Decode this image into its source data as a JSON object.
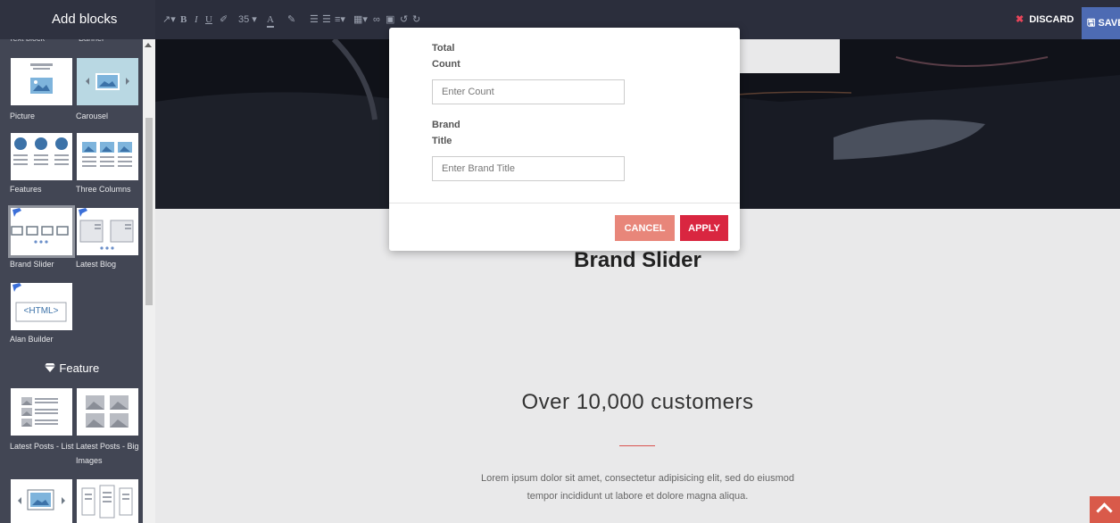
{
  "sidebar": {
    "title": "Add blocks",
    "cut_labels": [
      "Text block",
      "Banner"
    ],
    "blocks": [
      {
        "label": "Picture"
      },
      {
        "label": "Carousel"
      },
      {
        "label": "Features"
      },
      {
        "label": "Three Columns"
      },
      {
        "label": "Brand Slider"
      },
      {
        "label": "Latest Blog"
      },
      {
        "label": "Alan Builder",
        "tile_text": "<HTML>"
      },
      {
        "label": "Latest Posts - List"
      },
      {
        "label": "Latest Posts - Big Images"
      }
    ],
    "section_title": "Feature"
  },
  "toolbar": {
    "font_size": "35",
    "discard_label": "DISCARD",
    "save_label": "SAVE"
  },
  "content": {
    "heading": "Brand Slider",
    "customers_heading": "Over 10,000 customers",
    "lorem_line1": "Lorem ipsum dolor sit amet, consectetur adipisicing elit, sed do eiusmod",
    "lorem_line2": "tempor incididunt ut labore et dolore magna aliqua."
  },
  "modal": {
    "count_label_1": "Total",
    "count_label_2": "Count",
    "count_placeholder": "Enter Count",
    "brand_label_1": "Brand",
    "brand_label_2": "Title",
    "brand_placeholder": "Enter Brand Title",
    "cancel_label": "CANCEL",
    "apply_label": "APPLY"
  },
  "colors": {
    "sidebar_bg": "#424654",
    "toolbar_bg": "#2b2e3c",
    "apply": "#d92640",
    "cancel": "#e8867a",
    "save": "#4d6bb3",
    "discard_x": "#e8455a"
  }
}
